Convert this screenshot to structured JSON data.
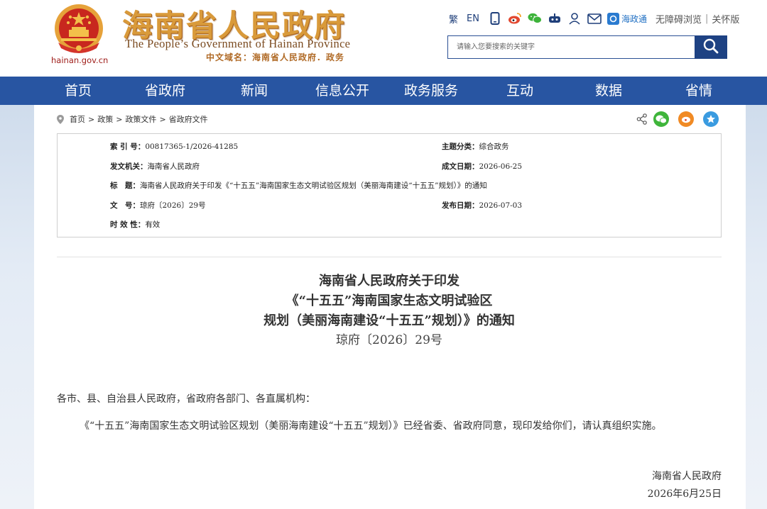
{
  "header": {
    "site_name_cn": "海南省人民政府",
    "site_name_en": "The People’s Government of Hainan Province",
    "domain_cn": "中文域名：海南省人民政府．政务",
    "domain": "hainan.gov.cn"
  },
  "top_links": {
    "traditional": "繁",
    "english": "EN",
    "hzt": "海政通",
    "accessibility": "无障碍浏览",
    "separator": "|",
    "care": "关怀版"
  },
  "search": {
    "placeholder": "请输入您要搜索的关键字"
  },
  "nav": {
    "items": [
      "首页",
      "省政府",
      "新闻",
      "信息公开",
      "政务服务",
      "互动",
      "数据",
      "省情"
    ]
  },
  "breadcrumb": {
    "items": [
      "首页",
      "政策",
      "政策文件",
      "省政府文件"
    ],
    "arrow": ">"
  },
  "meta": {
    "index_label": "索 引 号：",
    "index_value": "00817365-1/2026-41285",
    "category_label": "主题分类：",
    "category_value": "综合政务",
    "issuer_label": "发文机关：",
    "issuer_value": "海南省人民政府",
    "written_label": "成文日期：",
    "written_value": "2026-06-25",
    "title_label": "标　题：",
    "title_value": "海南省人民政府关于印发《“十五五”海南国家生态文明试验区规划（美丽海南建设“十五五”规划）》的通知",
    "docno_label": "文　号：",
    "docno_value": "琼府〔2026〕29号",
    "published_label": "发布日期：",
    "published_value": "2026-07-03",
    "validity_label": "时 效 性：",
    "validity_value": "有效"
  },
  "document": {
    "title_line1": "海南省人民政府关于印发",
    "title_line2": "《“十五五”海南国家生态文明试验区",
    "title_line3": "规划（美丽海南建设“十五五”规划）》的通知",
    "doc_number": "琼府〔2026〕29号",
    "salutation": "各市、县、自治县人民政府，省政府各部门、各直属机构：",
    "paragraph1": "《“十五五”海南国家生态文明试验区规划（美丽海南建设“十五五”规划）》已经省委、省政府同意，现印发给你们，请认真组织实施。",
    "signer": "海南省人民政府",
    "sign_date": "2026年6月25日"
  },
  "colors": {
    "nav_bg": "#2855a2",
    "brand_gold": "#d99a3a",
    "emblem_red": "#c0231b",
    "link_blue": "#1f3f7a"
  },
  "icons": [
    "emblem-icon",
    "mobile-icon",
    "weibo-icon",
    "wechat-icon",
    "robot-icon",
    "user-icon",
    "mail-icon",
    "search-icon",
    "location-pin-icon",
    "share-icon",
    "favorite-star-icon"
  ]
}
